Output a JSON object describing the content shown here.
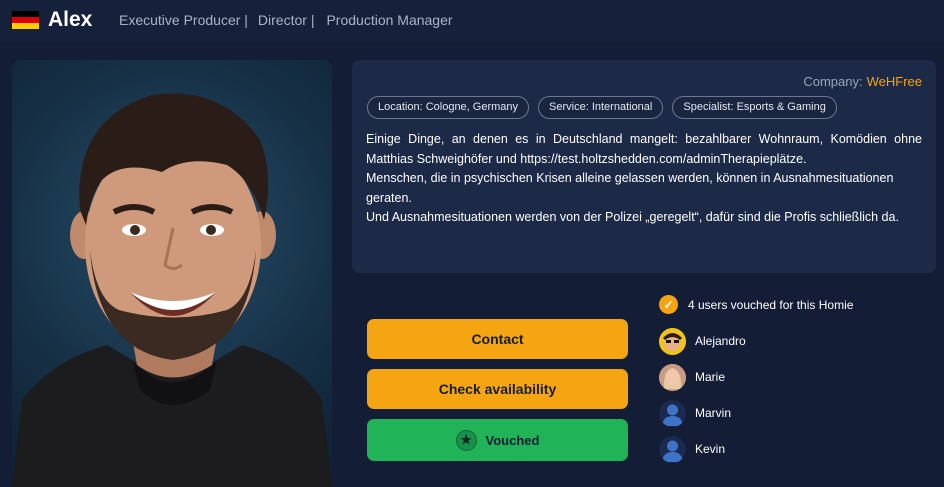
{
  "header": {
    "flag": "germany-flag",
    "flag_colors": [
      "#000000",
      "#dd0000",
      "#ffce00"
    ],
    "name": "Alex",
    "roles": [
      "Executive Producer |",
      "Director |",
      "Production Manager"
    ]
  },
  "company": {
    "label": "Company:",
    "value": "WeHFree"
  },
  "tags": [
    "Location: Cologne, Germany",
    "Service: International",
    "Specialist: Esports & Gaming"
  ],
  "bio": [
    "Einige Dinge, an denen es in Deutschland mangelt: bezahlbarer Wohnraum, Komödien ohne Matthias Schweighöfer und https://test.holtzshedden.com/adminTherapieplätze.",
    "Menschen, die in psychischen Krisen alleine gelassen werden, können in Ausnahmesituationen geraten.",
    "Und Ausnahmesituationen werden von der Polizei „geregelt“, dafür sind die Profis schließlich da."
  ],
  "buttons": {
    "contact": "Contact",
    "availability": "Check availability",
    "vouched": "Vouched"
  },
  "vouches": {
    "summary": "4 users vouched for this Homie",
    "users": [
      {
        "name": "Alejandro",
        "avatar": "alejandro-avatar"
      },
      {
        "name": "Marie",
        "avatar": "marie-avatar"
      },
      {
        "name": "Marvin",
        "avatar": "default-user-avatar"
      },
      {
        "name": "Kevin",
        "avatar": "default-user-avatar"
      }
    ]
  },
  "colors": {
    "background": "#141d36",
    "card": "#1c2947",
    "accent_orange": "#f5a511",
    "vouched_green": "#21b357"
  }
}
